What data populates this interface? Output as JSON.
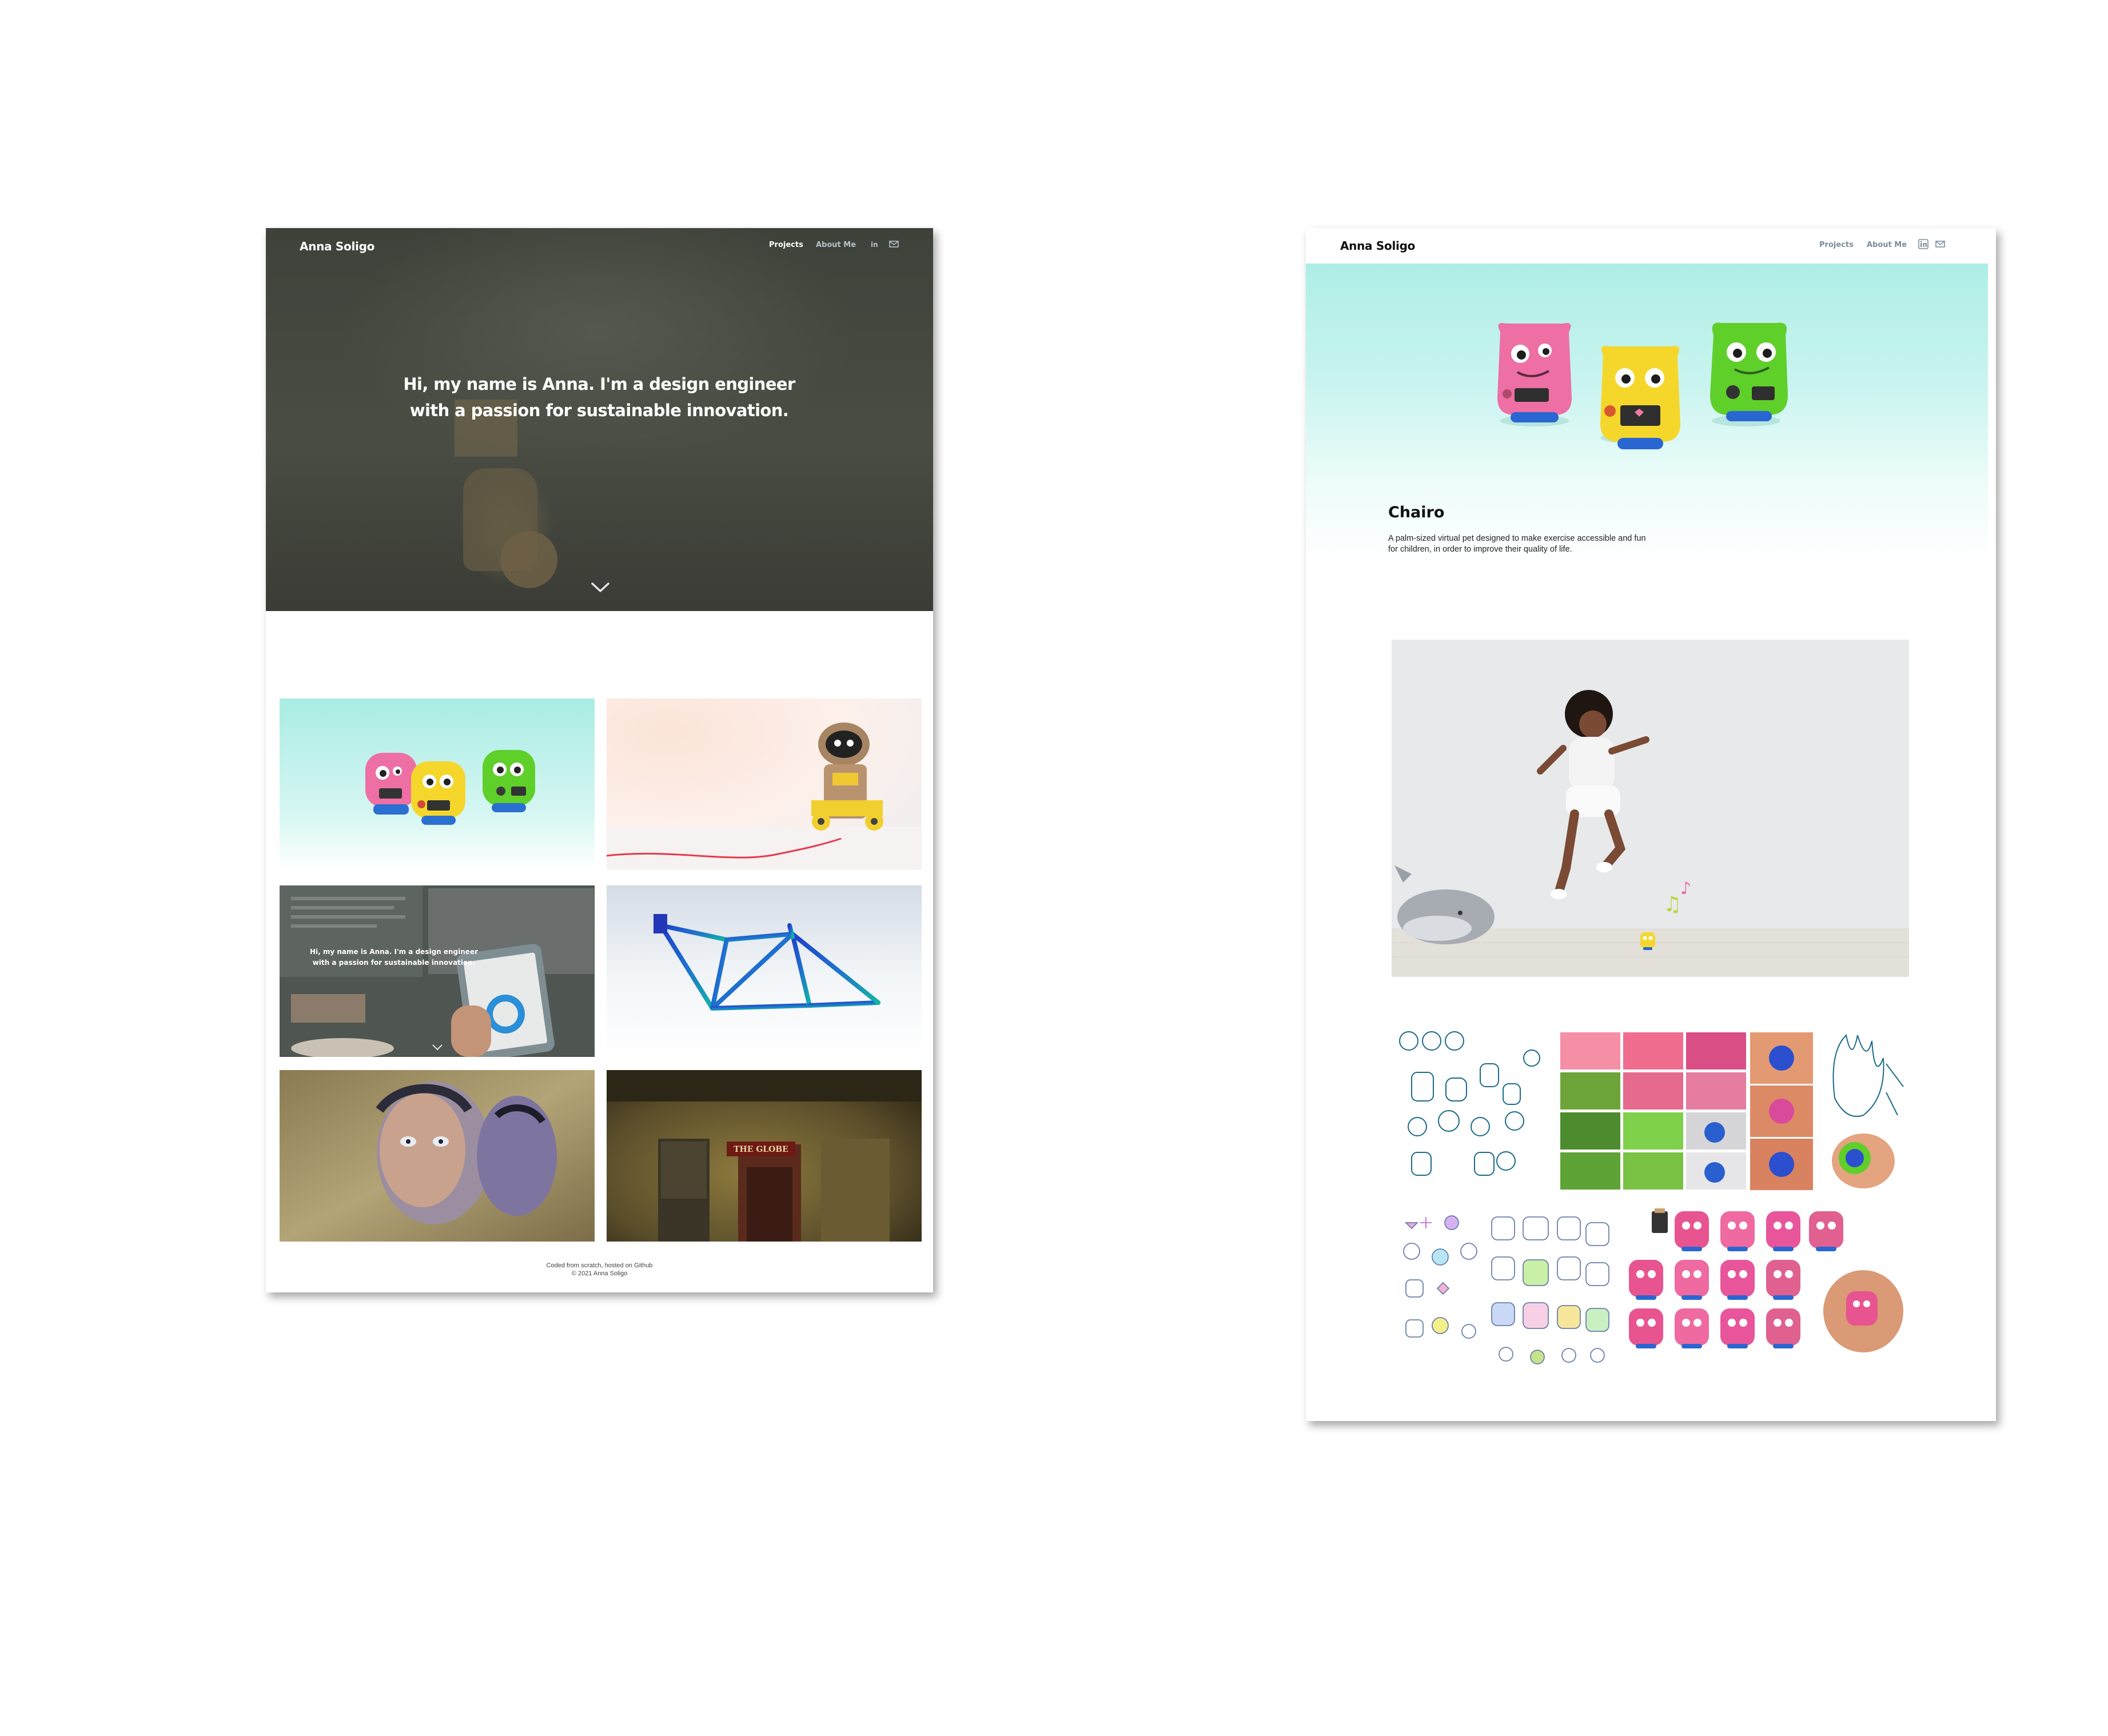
{
  "home": {
    "brand": "Anna Soligo",
    "nav": {
      "projects": "Projects",
      "about": "About Me"
    },
    "icons": {
      "linkedin": "linkedin-icon",
      "mail": "mail-icon",
      "scroll": "chevron-down-icon"
    },
    "hero_title_line1": "Hi, my name is Anna. I'm a design engineer",
    "hero_title_line2": "with a passion for sustainable innovation.",
    "thumb_hero_line1": "Hi, my name is Anna. I'm a design engineer",
    "thumb_hero_line2": "with a passion for sustainable innovation.",
    "footer_line1": "Coded from scratch, hosted on Github",
    "footer_line2": "© 2021 Anna Soligo",
    "sign_text": "THE GLOBE"
  },
  "project": {
    "brand": "Anna Soligo",
    "nav": {
      "projects": "Projects",
      "about": "About Me"
    },
    "title": "Chairo",
    "description": "A palm-sized virtual pet designed to make exercise accessible and fun for children, in order to improve their quality of life."
  },
  "colors": {
    "mint": "#aeeee6",
    "pet_pink": "#ee6fa4",
    "pet_yellow": "#f5d72b",
    "pet_green": "#5fcf2a",
    "nav_muted": "#7c8d9a"
  }
}
